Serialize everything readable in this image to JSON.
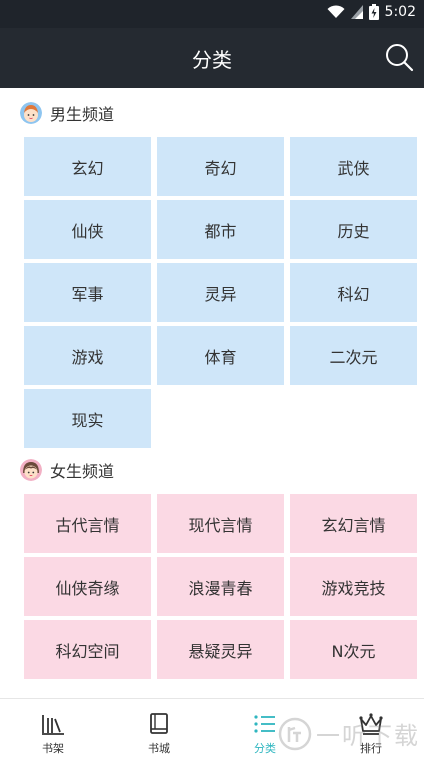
{
  "status_bar": {
    "time": "5:02"
  },
  "header": {
    "title": "分类",
    "search_icon": "search-icon"
  },
  "male_section": {
    "title": "男生频道",
    "categories": [
      "玄幻",
      "奇幻",
      "武侠",
      "仙侠",
      "都市",
      "历史",
      "军事",
      "灵异",
      "科幻",
      "游戏",
      "体育",
      "二次元",
      "现实"
    ]
  },
  "female_section": {
    "title": "女生频道",
    "categories": [
      "古代言情",
      "现代言情",
      "玄幻言情",
      "仙侠奇缘",
      "浪漫青春",
      "游戏竞技",
      "科幻空间",
      "悬疑灵异",
      "N次元"
    ]
  },
  "tabs": [
    {
      "label": "书架",
      "icon": "bookshelf-icon",
      "active": false
    },
    {
      "label": "书城",
      "icon": "book-icon",
      "active": false
    },
    {
      "label": "分类",
      "icon": "list-icon",
      "active": true
    },
    {
      "label": "排行",
      "icon": "crown-icon",
      "active": false
    }
  ],
  "colors": {
    "accent": "#2fb6c0",
    "male_tile": "#cfe6f9",
    "female_tile": "#fbd9e4",
    "header_bg": "#252a31"
  },
  "watermark": {
    "text": "一听下载"
  }
}
